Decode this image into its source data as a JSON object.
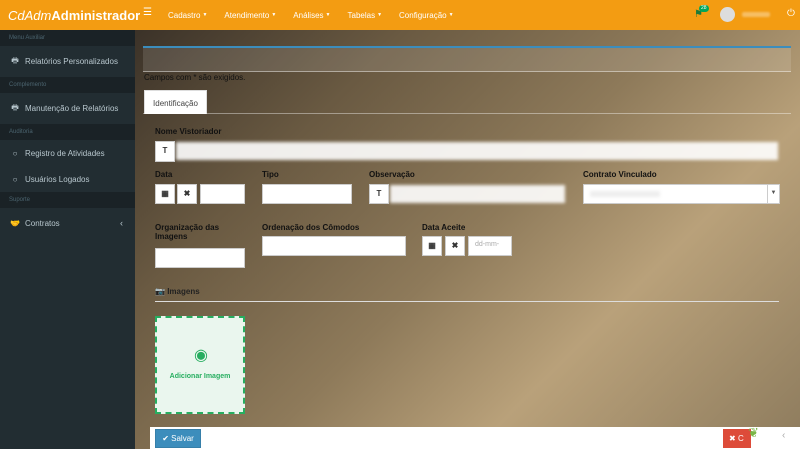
{
  "brand": {
    "italic": "CdAdm",
    "bold": "Administrador"
  },
  "topnav": {
    "menu_icon": "bars-icon",
    "items": [
      "Cadastro",
      "Atendimento",
      "Análises",
      "Tabelas",
      "Configuração"
    ],
    "notification_count": "28",
    "colors": {
      "topbar": "#f39c12",
      "sidebar": "#222d32",
      "primary": "#3c8dbc",
      "success": "#27ae60",
      "danger": "#dd4b39"
    }
  },
  "sidebar": {
    "sections": [
      {
        "header": "Menu Auxiliar",
        "items": [
          {
            "label": "Relatórios Personalizados",
            "icon": "print-icon"
          }
        ]
      },
      {
        "header": "Complemento",
        "items": [
          {
            "label": "Manutenção de Relatórios",
            "icon": "print-icon"
          }
        ]
      },
      {
        "header": "Auditoria",
        "items": [
          {
            "label": "Registro de Atividades",
            "icon": "circle-icon"
          },
          {
            "label": "Usuários Logados",
            "icon": "circle-icon"
          }
        ]
      },
      {
        "header": "Suporte",
        "items": [
          {
            "label": "Contratos",
            "icon": "handshake-icon"
          }
        ]
      }
    ]
  },
  "form": {
    "required_note": "Campos com * são exigidos.",
    "tab": "Identificação",
    "nome_vistoriador_label": "Nome Vistoriador",
    "data_label": "Data",
    "tipo_label": "Tipo",
    "observacao_label": "Observação",
    "contrato_label": "Contrato Vinculado",
    "organizacao_label_1": "Organização das",
    "organizacao_label_2": "Imagens",
    "ordenacao_label": "Ordenação dos Cômodos",
    "data_aceite_label": "Data Aceite",
    "data_aceite_placeholder": "dd-mm-",
    "text_addon": "T",
    "images_section": "Imagens",
    "add_image": "Adicionar Imagem"
  },
  "footer": {
    "save": "Salvar",
    "cancel": "C"
  }
}
